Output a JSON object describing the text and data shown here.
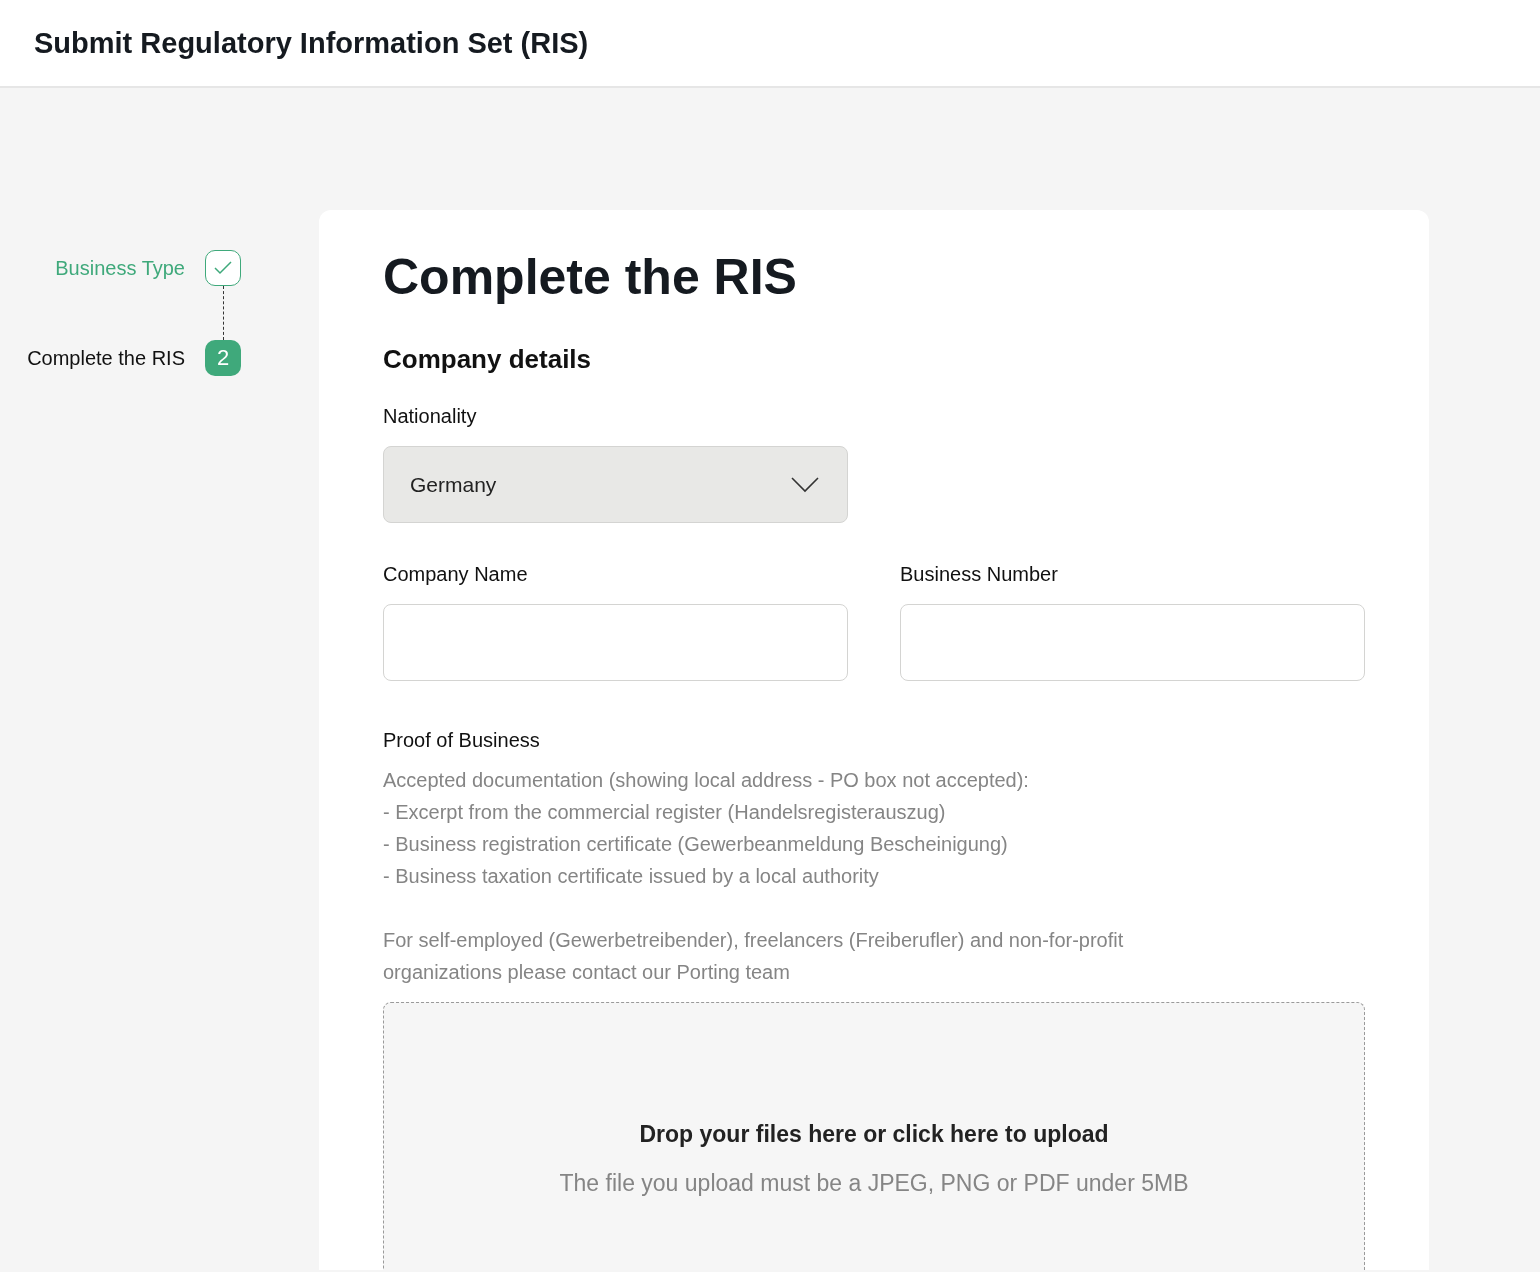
{
  "header": {
    "title": "Submit Regulatory Information Set (RIS)"
  },
  "steps": [
    {
      "label": "Business Type",
      "completed": true
    },
    {
      "label": "Complete the RIS",
      "completed": false,
      "number": "2"
    }
  ],
  "form": {
    "title": "Complete the RIS",
    "section": "Company details",
    "nationality": {
      "label": "Nationality",
      "value": "Germany"
    },
    "fields": [
      {
        "label": "Company Name"
      },
      {
        "label": "Business Number"
      }
    ],
    "proof": {
      "label": "Proof of Business",
      "lines": [
        "Accepted documentation (showing local address - PO box not accepted):",
        "- Excerpt from the commercial register (Handelsregisterauszug)",
        "- Business registration certificate (Gewerbeanmeldung Bescheinigung)",
        "- Business taxation certificate issued by a local authority"
      ],
      "note": "For self-employed (Gewerbetreibender), freelancers (Freiberufler) and non-for-profit organizations please contact our Porting team"
    },
    "upload": {
      "title": "Drop your files here or click here to upload",
      "hint": "The file you upload must be a JPEG, PNG or PDF under 5MB"
    }
  }
}
